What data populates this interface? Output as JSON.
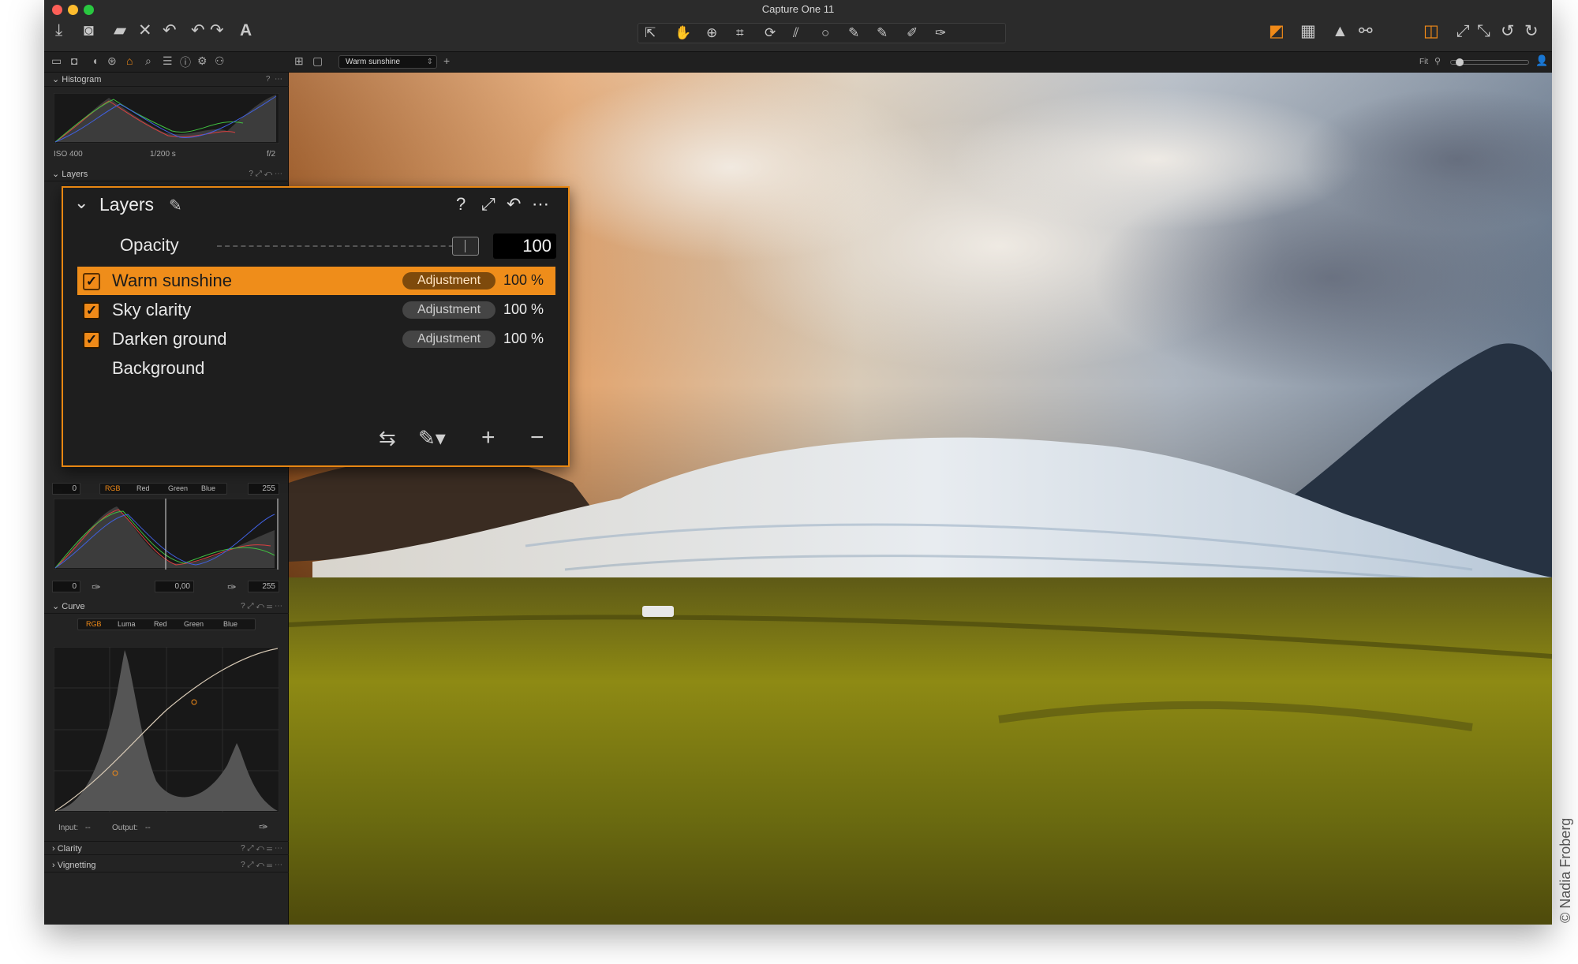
{
  "window": {
    "title": "Capture One 11"
  },
  "toolbar": {
    "left_icons": [
      "import-icon",
      "camera-icon",
      "folder-move-icon",
      "delete-icon",
      "undo-icon",
      "undo-icon",
      "redo-icon",
      "text-icon"
    ],
    "center_tools": [
      "select-tool-icon",
      "pan-tool-icon",
      "zoom-tool-icon",
      "crop-tool-icon",
      "rotate-tool-icon",
      "keystone-tool-icon",
      "spot-tool-icon",
      "brush-tool-icon",
      "brush-tool-icon",
      "erase-tool-icon",
      "picker-tool-icon"
    ],
    "right_icons": [
      "before-after-icon",
      "grid-icon",
      "warning-icon",
      "glasses-icon",
      "stack-icon",
      "expand-icon",
      "collapse-icon",
      "rotate-left-icon",
      "rotate-right-icon"
    ]
  },
  "toolbar2": {
    "variant_label": "Warm sunshine",
    "fit_label": "Fit"
  },
  "sidebar": {
    "histogram": {
      "title": "Histogram",
      "iso": "ISO 400",
      "shutter": "1/200 s",
      "aperture": "f/2"
    },
    "layers_mini_title": "Layers",
    "levels": {
      "tabs": [
        "RGB",
        "Red",
        "Green",
        "Blue"
      ],
      "in_low": "0",
      "in_high": "255",
      "out_low": "0",
      "mid": "0,00",
      "out_high": "255"
    },
    "curve": {
      "title": "Curve",
      "tabs": [
        "RGB",
        "Luma",
        "Red",
        "Green",
        "Blue"
      ],
      "input_label": "Input:",
      "input_value": "--",
      "output_label": "Output:",
      "output_value": "--"
    },
    "clarity_title": "Clarity",
    "vignetting_title": "Vignetting"
  },
  "layers_panel": {
    "title": "Layers",
    "opacity_label": "Opacity",
    "opacity_value": "100",
    "rows": [
      {
        "name": "Warm sunshine",
        "type": "Adjustment",
        "opacity": "100 %",
        "checked": true,
        "selected": true
      },
      {
        "name": "Sky clarity",
        "type": "Adjustment",
        "opacity": "100 %",
        "checked": true,
        "selected": false
      },
      {
        "name": "Darken ground",
        "type": "Adjustment",
        "opacity": "100 %",
        "checked": true,
        "selected": false
      },
      {
        "name": "Background",
        "type": "",
        "opacity": "",
        "checked": false,
        "selected": false
      }
    ]
  },
  "credit": "© Nadia Froberg",
  "colors": {
    "accent": "#f08a18",
    "panel": "#1e1e1e",
    "sidebar": "#232323"
  }
}
